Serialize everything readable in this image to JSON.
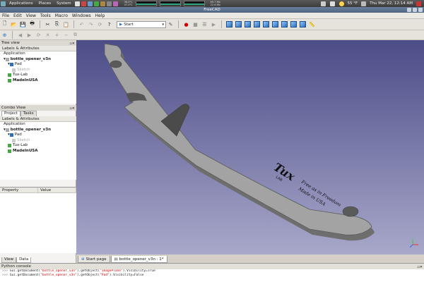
{
  "panel": {
    "applications": "Applications",
    "places": "Places",
    "system": "System",
    "cpu_lines": [
      "38.0°C",
      "47.0°C"
    ],
    "mem_lines": [
      "69.7 Mb",
      "22.6 Mb"
    ],
    "weather": "55 °F",
    "datetime": "Thu Mar 22, 12:14 AM"
  },
  "window": {
    "title": "FreeCAD"
  },
  "menu": [
    "File",
    "Edit",
    "View",
    "Tools",
    "Macro",
    "Windows",
    "Help"
  ],
  "toolbar": {
    "workbench": "Start"
  },
  "tree_view": {
    "title": "Tree view",
    "header": "Labels & Attributes",
    "items": [
      {
        "label": "Application"
      },
      {
        "label": "bottle_opener_v3n"
      },
      {
        "label": "Pad"
      },
      {
        "label": "Sketch"
      },
      {
        "label": "Tux-Lab"
      },
      {
        "label": "MadeInUSA"
      }
    ]
  },
  "combo_view": {
    "title": "Combo View",
    "tabs": [
      "Project",
      "Tasks"
    ],
    "header": "Labels & Attributes",
    "items": [
      {
        "label": "Application"
      },
      {
        "label": "bottle_opener_v3n"
      },
      {
        "label": "Pad"
      },
      {
        "label": "Sketch"
      },
      {
        "label": "Tux-Lab"
      },
      {
        "label": "MadeInUSA"
      }
    ],
    "property_cols": [
      "Property",
      "Value"
    ],
    "bottom_tabs": [
      "View",
      "Data"
    ]
  },
  "model": {
    "engrave_logo": "Tux",
    "engrave_sub": "LAB",
    "engrave_line1": "Free as in Freedom",
    "engrave_line2": "Made in USA"
  },
  "doc_tabs": [
    "Start page",
    "bottle_opener_v3n : 1*"
  ],
  "console": {
    "title": "Python console",
    "lines": [
      {
        "prompt": ">>>",
        "pre": " Gui.getDocument(",
        "doc": "\"bottle_opener_v3n\"",
        "mid": ").getObject(",
        "obj": "\"ImagePlane\"",
        "post": ").Visibility=True"
      },
      {
        "prompt": ">>>",
        "pre": " Gui.getDocument(",
        "doc": "\"bottle_opener_v3n\"",
        "mid": ").getObject(",
        "obj": "\"Pad\"",
        "post": ").Visibility=False"
      }
    ]
  },
  "colors": {
    "background_top": "#4c4c88",
    "background_bottom": "#a8a8ca",
    "model_grey": "#9a9a9a",
    "selected_red": "#d00000"
  }
}
